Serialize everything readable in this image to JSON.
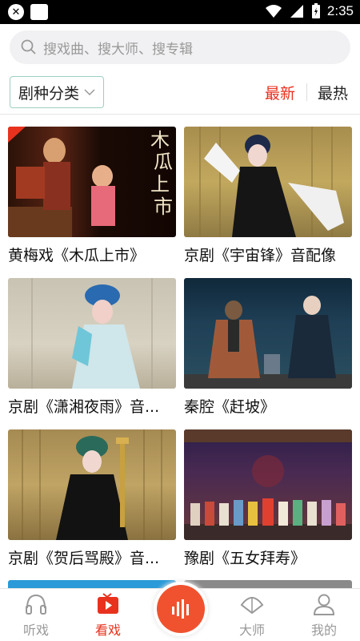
{
  "status_bar": {
    "time": "2:35"
  },
  "search": {
    "placeholder": "搜戏曲、搜大师、搜专辑"
  },
  "filter": {
    "genre_label": "剧种分类",
    "sort_newest": "最新",
    "sort_hottest": "最热",
    "active_sort": "最新"
  },
  "videos": [
    {
      "title": "黄梅戏《木瓜上市》",
      "poster_text": "木瓜上市"
    },
    {
      "title": "京剧《宇宙锋》音配像"
    },
    {
      "title": "京剧《潇湘夜雨》音..."
    },
    {
      "title": "秦腔《赶坡》"
    },
    {
      "title": "京剧《贺后骂殿》音..."
    },
    {
      "title": "豫剧《五女拜寿》"
    }
  ],
  "tabbar": {
    "listen": "听戏",
    "watch": "看戏",
    "masters": "大师",
    "mine": "我的",
    "active": "看戏"
  },
  "colors": {
    "accent": "#e8321e",
    "center_button": "#f0522f",
    "genre_border": "#9cd0c3"
  }
}
